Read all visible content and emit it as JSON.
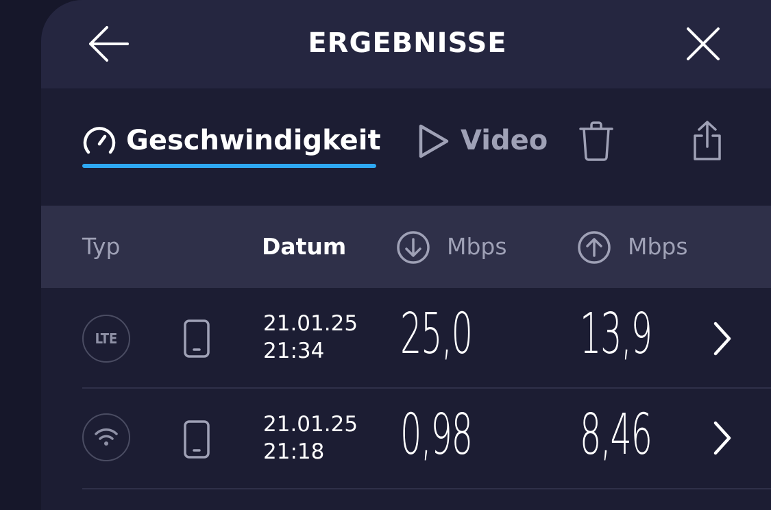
{
  "header": {
    "title": "ERGEBNISSE"
  },
  "tabs": [
    {
      "label": "Geschwindigkeit",
      "active": true
    },
    {
      "label": "Video",
      "active": false
    }
  ],
  "columns": {
    "typ": "Typ",
    "datum": "Datum",
    "download_unit": "Mbps",
    "upload_unit": "Mbps"
  },
  "rows": [
    {
      "type": "LTE",
      "type_icon": "lte-icon",
      "device_icon": "smartphone-icon",
      "date": "21.01.25",
      "time": "21:34",
      "download": "25,0",
      "upload": "13,9"
    },
    {
      "type": "wifi",
      "type_icon": "wifi-icon",
      "device_icon": "smartphone-icon",
      "date": "21.01.25",
      "time": "21:18",
      "download": "0,98",
      "upload": "8,46"
    }
  ],
  "colors": {
    "background": "#1c1d33",
    "header": "#252640",
    "column_header": "#2f3049",
    "accent": "#2ea8f2",
    "muted": "#9fa1b6"
  }
}
